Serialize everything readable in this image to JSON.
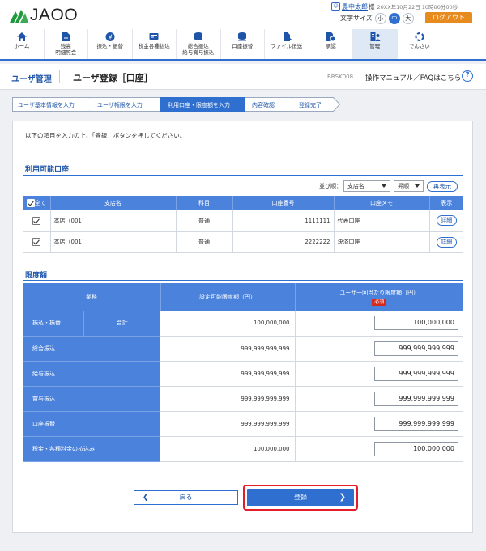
{
  "header": {
    "logo_text": "JAOO",
    "user_name": "農中太郎",
    "user_suffix": "様",
    "login_time": "20XX年10月22日 10時00分00秒",
    "font_size_label": "文字サイズ",
    "font_sizes": [
      "小",
      "中",
      "大"
    ],
    "logout_label": "ログアウト"
  },
  "nav": [
    {
      "label": "ホーム",
      "icon": "home-icon"
    },
    {
      "label": "残高\n明細照会",
      "icon": "balance-icon"
    },
    {
      "label": "振込・振替",
      "icon": "transfer-icon"
    },
    {
      "label": "税金各種払込",
      "icon": "tax-icon"
    },
    {
      "label": "総合振込\n給与賞与振込",
      "icon": "bulk-transfer-icon"
    },
    {
      "label": "口座振替",
      "icon": "account-transfer-icon"
    },
    {
      "label": "ファイル伝送",
      "icon": "file-transfer-icon"
    },
    {
      "label": "承認",
      "icon": "approval-icon"
    },
    {
      "label": "管理",
      "icon": "admin-icon"
    },
    {
      "label": "でんさい",
      "icon": "densai-icon"
    }
  ],
  "page": {
    "section": "ユーザ管理",
    "title": "ユーザ登録［口座］",
    "code": "BRSK008",
    "manual_link": "操作マニュアル／FAQはこちら",
    "help_icon": "?"
  },
  "steps": [
    "ユーザ基本情報を入力",
    "ユーザ権限を入力",
    "利用口座・限度額を入力",
    "内容確認",
    "登録完了"
  ],
  "intro": "以下の項目を入力の上、「登録」ボタンを押してください。",
  "accounts": {
    "title": "利用可能口座",
    "sort_label": "並び順：",
    "sort_field": "支店名",
    "sort_order": "昇順",
    "redisplay": "再表示",
    "headers": [
      "全て",
      "支店名",
      "科目",
      "口座番号",
      "口座メモ",
      "表示"
    ],
    "rows": [
      {
        "branch": "本店（001）",
        "type": "普通",
        "number": "1111111",
        "memo": "代表口座",
        "action": "詳細"
      },
      {
        "branch": "本店（001）",
        "type": "普通",
        "number": "2222222",
        "memo": "決済口座",
        "action": "詳細"
      }
    ]
  },
  "limits": {
    "title": "限度額",
    "headers": [
      "業務",
      "設定可能限度額（円）",
      "ユーザ一回当たり限度額（円）"
    ],
    "required": "必須",
    "rows": [
      {
        "label": "振込・振替",
        "sub": "合計",
        "max": "100,000,000",
        "value": "100,000,000"
      },
      {
        "label": "総合振込",
        "max": "999,999,999,999",
        "value": "999,999,999,999"
      },
      {
        "label": "給与振込",
        "max": "999,999,999,999",
        "value": "999,999,999,999"
      },
      {
        "label": "賞与振込",
        "max": "999,999,999,999",
        "value": "999,999,999,999"
      },
      {
        "label": "口座振替",
        "max": "999,999,999,999",
        "value": "999,999,999,999"
      },
      {
        "label": "税金・各種料金の払込み",
        "max": "100,000,000",
        "value": "100,000,000"
      }
    ]
  },
  "buttons": {
    "back": "戻る",
    "register": "登録"
  },
  "colors": {
    "primary": "#2e6fd0",
    "accent": "#e88b1e",
    "highlight": "#e31e2a"
  }
}
